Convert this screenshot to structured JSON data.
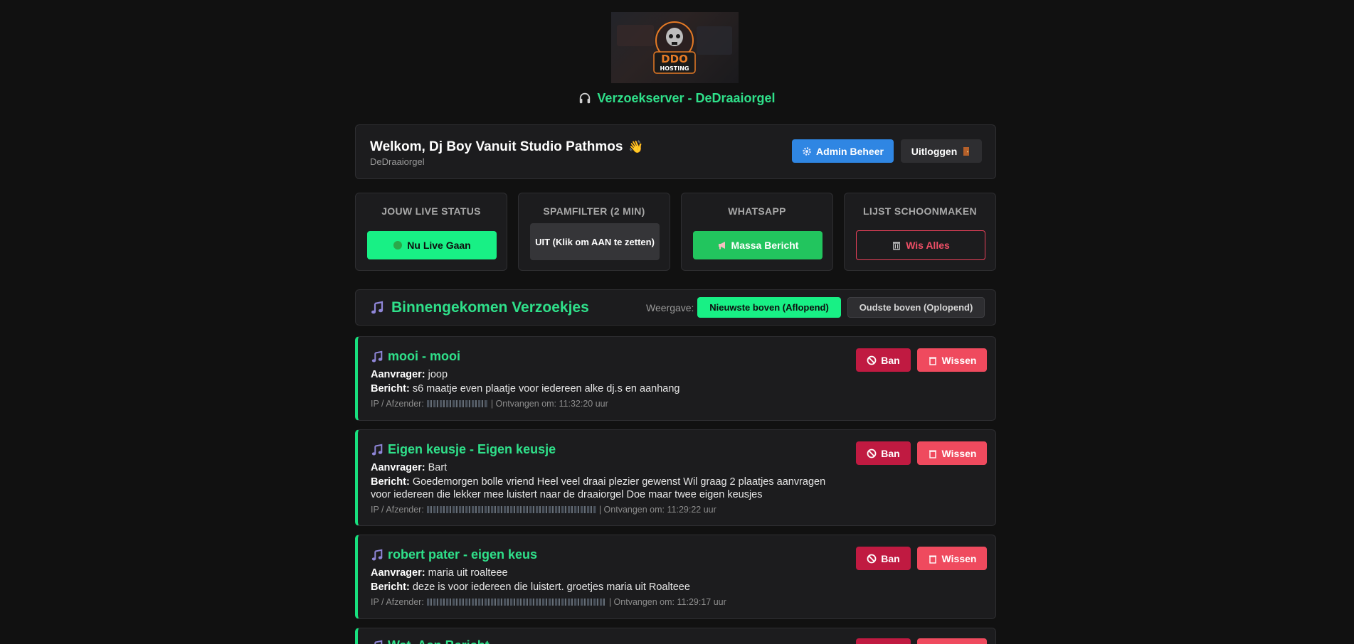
{
  "header": {
    "title": "Verzoekserver - DeDraaiorgel",
    "logo_text": "DDO",
    "logo_subtext": "HOSTING"
  },
  "welcome": {
    "title": "Welkom, Dj Boy Vanuit Studio Pathmos",
    "wave": "👋",
    "subtitle": "DeDraaiorgel",
    "admin_label": "Admin Beheer",
    "logout_label": "Uitloggen"
  },
  "panels": [
    {
      "title": "JOUW LIVE STATUS",
      "button": "Nu Live Gaan"
    },
    {
      "title": "SPAMFILTER (2 MIN)",
      "button": "UIT (Klik om AAN te zetten)"
    },
    {
      "title": "WHATSAPP",
      "button": "Massa Bericht"
    },
    {
      "title": "LIJST SCHOONMAKEN",
      "button": "Wis Alles"
    }
  ],
  "list": {
    "title": "Binnengekomen Verzoekjes",
    "view_label": "Weergave:",
    "newest_label": "Nieuwste boven (Aflopend)",
    "oldest_label": "Oudste boven (Oplopend)"
  },
  "labels": {
    "requester": "Aanvrager:",
    "message": "Bericht:",
    "ip": "IP / Afzender:",
    "received": "| Ontvangen om:",
    "ban": "Ban",
    "wissen": "Wissen"
  },
  "requests": [
    {
      "title": "mooi - mooi",
      "requester": "joop",
      "message": "s6 maatje even plaatje voor iedereen alke dj.s en aanhang",
      "received": "11:32:20 uur"
    },
    {
      "title": "Eigen keusje - Eigen keusje",
      "requester": "Bart",
      "message": "Goedemorgen bolle vriend Heel veel draai plezier gewenst Wil graag 2 plaatjes aanvragen voor iedereen die lekker mee luistert naar de draaiorgel Doe maar twee eigen keusjes",
      "received": "11:29:22 uur"
    },
    {
      "title": "robert pater - eigen keus",
      "requester": "maria uit roalteee",
      "message": "deze is voor iedereen die luistert. groetjes maria uit Roalteee",
      "received": "11:29:17 uur"
    },
    {
      "title": "Wat. Aan Bericht",
      "requester": "",
      "message": "",
      "received": ""
    }
  ],
  "colors": {
    "accent": "#2fe08a",
    "live": "#18f085",
    "danger": "#c01a41",
    "admin": "#2f86e3"
  }
}
